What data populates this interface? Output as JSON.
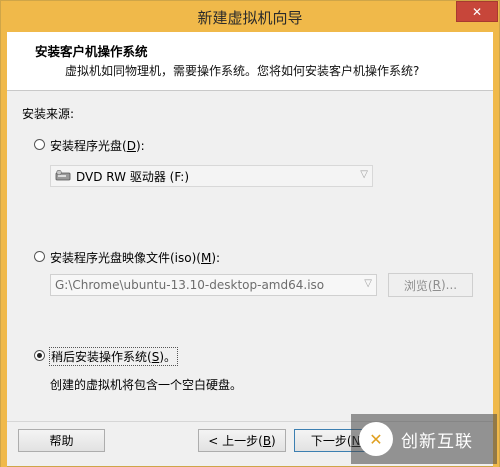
{
  "window": {
    "title": "新建虚拟机向导",
    "close_glyph": "✕",
    "accent_color": "#f0b94a"
  },
  "header": {
    "title": "安装客户机操作系统",
    "subtitle": "虚拟机如同物理机，需要操作系统。您将如何安装客户机操作系统?"
  },
  "source": {
    "group_label": "安装来源:",
    "disc_option": {
      "label_pre": "安装程序光盘(",
      "mnemonic": "D",
      "label_post": "):",
      "selected": false
    },
    "drive_select": {
      "value": "DVD RW 驱动器 (F:)",
      "icon": "dvd-drive-icon"
    },
    "iso_option": {
      "label_pre": "安装程序光盘映像文件(iso)(",
      "mnemonic": "M",
      "label_post": "):",
      "selected": false
    },
    "iso_select": {
      "value": "G:\\Chrome\\ubuntu-13.10-desktop-amd64.iso"
    },
    "browse_button": {
      "label_pre": "浏览(",
      "mnemonic": "R",
      "label_post": ")..."
    },
    "later_option": {
      "label_pre": "稍后安装操作系统(",
      "mnemonic": "S",
      "label_post": ")。",
      "selected": true
    },
    "later_description": "创建的虚拟机将包含一个空白硬盘。"
  },
  "footer": {
    "help_label": "帮助",
    "back_button": {
      "label_pre": "< 上一步(",
      "mnemonic": "B",
      "label_post": ")"
    },
    "next_button": {
      "label_pre": "下一步(",
      "mnemonic": "N",
      "label_post": ")"
    }
  },
  "watermark": {
    "text": "创新互联"
  }
}
